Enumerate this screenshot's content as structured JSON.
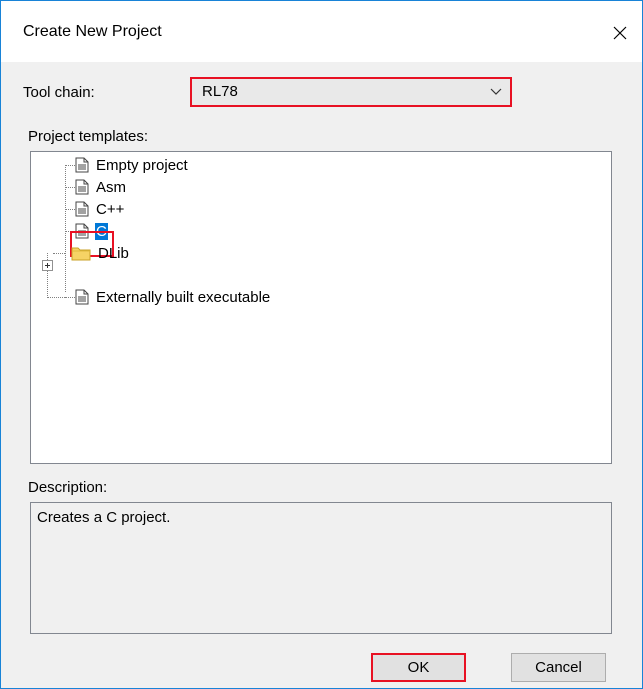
{
  "dialog": {
    "title": "Create New Project",
    "close_glyph": "✕"
  },
  "toolchain": {
    "label": "Tool chain:",
    "value": "RL78"
  },
  "templates": {
    "label": "Project templates:",
    "items": [
      {
        "label": "Empty project",
        "icon": "document-icon"
      },
      {
        "label": "Asm",
        "icon": "document-icon"
      },
      {
        "label": "C++",
        "icon": "document-icon"
      },
      {
        "label": "C",
        "icon": "document-icon",
        "selected": true
      },
      {
        "label": "DLib",
        "icon": "folder-icon",
        "expandable": true
      },
      {
        "label": "Externally built executable",
        "icon": "document-icon"
      }
    ]
  },
  "description": {
    "label": "Description:",
    "text": "Creates a C project."
  },
  "buttons": {
    "ok": "OK",
    "cancel": "Cancel"
  }
}
